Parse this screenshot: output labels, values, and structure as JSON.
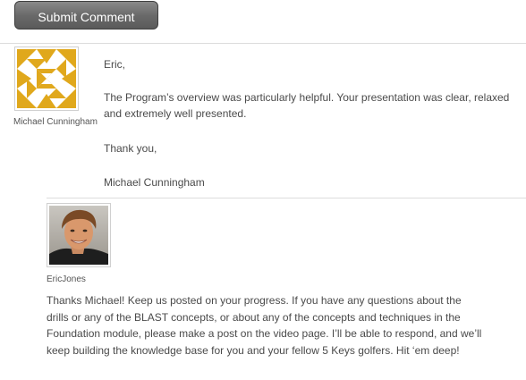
{
  "submit": {
    "label": "Submit Comment"
  },
  "comment1": {
    "author": "Michael Cunningham",
    "greeting": "Eric,",
    "body": "The Program’s overview was particularly helpful. Your presentation was clear, relaxed and extremely well presented.",
    "thanks": "Thank you,",
    "signature": "Michael Cunningham"
  },
  "comment2": {
    "author": "EricJones",
    "body": "Thanks Michael! Keep us posted on your progress. If you have any questions about the drills or any of the BLAST concepts, or about any of the concepts and techniques in the Foundation module, please make a post on the video page. I’ll be able to respond, and we’ll keep building the knowledge base for you and your fellow 5 Keys golfers. Hit ‘em deep!"
  },
  "colors": {
    "identicon": "#e0a81c",
    "divider": "#dcdcdc",
    "button": "#6a6a6a"
  }
}
